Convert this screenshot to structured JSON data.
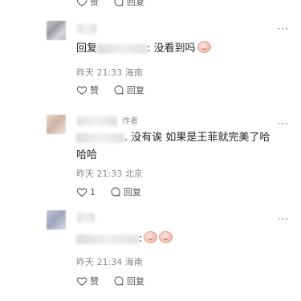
{
  "icons": {
    "like": "heart-outline-icon",
    "reply": "speech-bubble-icon",
    "more": "more-dots-icon",
    "emoji": "crying-face-emoji-icon"
  },
  "colors": {
    "text": "#222222",
    "meta": "#8a8a8a",
    "action": "#555555"
  },
  "top": {
    "like_label": "赞",
    "reply_label": "回复"
  },
  "comments": [
    {
      "prefix": "回复",
      "text": ": 没看到吗",
      "time": "昨天 21:33",
      "location": "海南",
      "like_label": "赞",
      "reply_label": "回复",
      "more": "···"
    },
    {
      "author_tag": "作者",
      "text_line1": ". 没有诶 如果是王菲就完美了哈",
      "text_line2": "哈哈",
      "time": "昨天 21:33",
      "location": "北京",
      "like_count": "1",
      "reply_label": "回复",
      "more": "···"
    },
    {
      "text": ":",
      "time": "昨天 21:34",
      "location": "海南",
      "like_label": "赞",
      "reply_label": "回复",
      "more": "···"
    }
  ]
}
